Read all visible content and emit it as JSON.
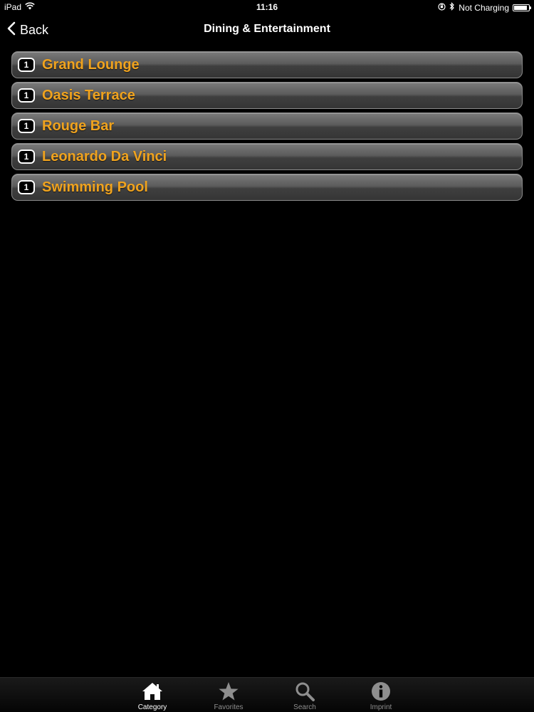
{
  "status_bar": {
    "device": "iPad",
    "time": "11:16",
    "battery_status": "Not Charging",
    "battery_level": 0.9
  },
  "nav": {
    "back_label": "Back",
    "title": "Dining & Entertainment"
  },
  "list": {
    "items": [
      {
        "count": "1",
        "label": "Grand Lounge"
      },
      {
        "count": "1",
        "label": "Oasis Terrace"
      },
      {
        "count": "1",
        "label": "Rouge Bar"
      },
      {
        "count": "1",
        "label": "Leonardo Da Vinci"
      },
      {
        "count": "1",
        "label": "Swimming Pool"
      }
    ]
  },
  "tab_bar": {
    "tabs": [
      {
        "label": "Category",
        "icon": "house-icon",
        "active": true
      },
      {
        "label": "Favorites",
        "icon": "star-icon",
        "active": false
      },
      {
        "label": "Search",
        "icon": "magnifier-icon",
        "active": false
      },
      {
        "label": "Imprint",
        "icon": "info-icon",
        "active": false
      }
    ]
  },
  "colors": {
    "accent": "#f0a31e",
    "background": "#000000"
  }
}
